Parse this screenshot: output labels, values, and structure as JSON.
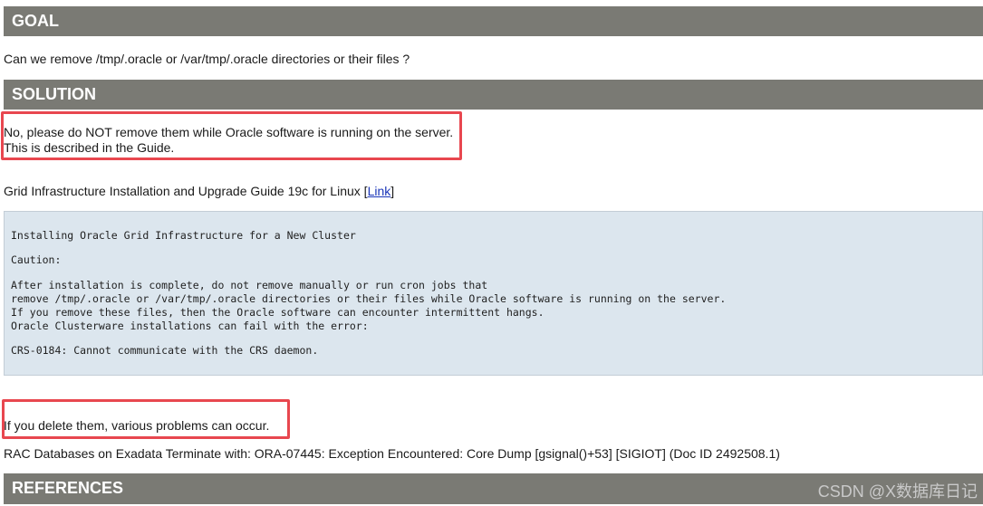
{
  "goal": {
    "heading": "GOAL",
    "question": "Can we remove /tmp/.oracle or /var/tmp/.oracle directories or their files ?"
  },
  "solution": {
    "heading": "SOLUTION",
    "answer_line1": "No, please do NOT remove them while Oracle software is running on the server.",
    "answer_line2": "This is described in the Guide.",
    "guide_text": "Grid Infrastructure Installation and Upgrade Guide 19c for Linux [",
    "guide_link": "Link",
    "guide_close": "]",
    "code_lines": [
      "Installing Oracle Grid Infrastructure for a New Cluster",
      "Caution:",
      "After installation is complete, do not remove manually or run cron jobs that",
      "remove /tmp/.oracle or /var/tmp/.oracle directories or their files while Oracle software is running on the server.",
      "If you remove these files, then the Oracle software can encounter intermittent hangs.",
      "Oracle Clusterware installations can fail with the error:",
      "CRS-0184: Cannot communicate with the CRS daemon."
    ],
    "delete_warning": "If you delete them, various problems can occur.",
    "related_note": "RAC Databases on Exadata Terminate with: ORA-07445: Exception Encountered: Core Dump [gsignal()+53] [SIGIOT] (Doc ID 2492508.1)"
  },
  "references": {
    "heading": "REFERENCES"
  },
  "watermark": "CSDN @X数据库日记",
  "colors": {
    "header_bar": "#7a7a74",
    "highlight_border": "#e8474f",
    "code_background": "#dce6ee",
    "link": "#1a35b8"
  }
}
